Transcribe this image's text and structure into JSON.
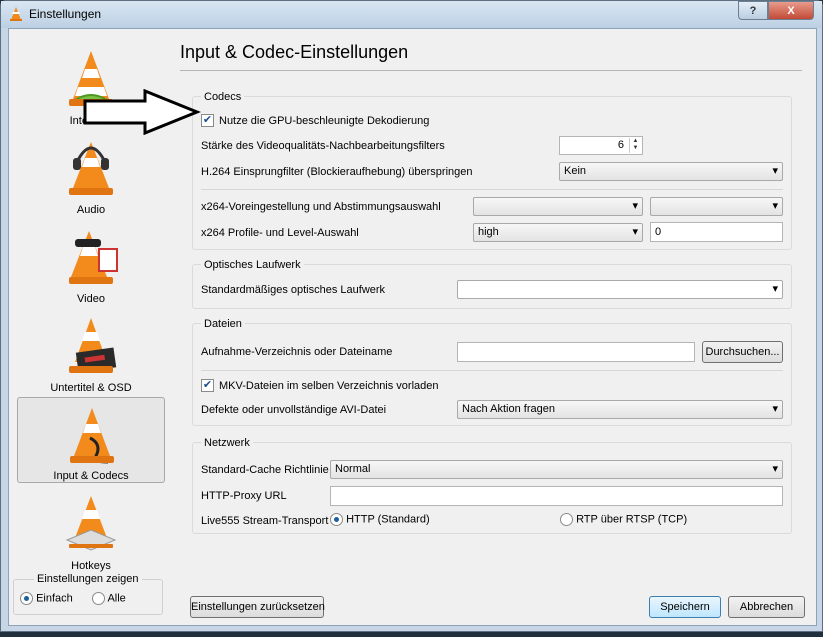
{
  "window": {
    "title": "Einstellungen",
    "help_label": "?",
    "close_label": "X"
  },
  "sidebar": {
    "items": [
      {
        "label": "Interface",
        "icon": "cone-interface-icon"
      },
      {
        "label": "Audio",
        "icon": "cone-audio-icon"
      },
      {
        "label": "Video",
        "icon": "cone-video-icon"
      },
      {
        "label": "Untertitel & OSD",
        "icon": "cone-subtitles-icon"
      },
      {
        "label": "Input & Codecs",
        "icon": "cone-input-codecs-icon",
        "selected": true
      },
      {
        "label": "Hotkeys",
        "icon": "cone-hotkeys-icon"
      }
    ],
    "show_settings": {
      "title": "Einstellungen zeigen",
      "simple": "Einfach",
      "all": "Alle",
      "selected": "Einfach"
    }
  },
  "page": {
    "title": "Input & Codec-Einstellungen"
  },
  "codecs": {
    "title": "Codecs",
    "gpu_label": "Nutze die GPU-beschleunigte Dekodierung",
    "gpu_checked": true,
    "pp_label": "Stärke des Videoqualitäts-Nachbearbeitungsfilters",
    "pp_value": "6",
    "h264_label": "H.264 Einsprungfilter (Blockieraufhebung) überspringen",
    "h264_value": "Kein",
    "x264_preset_label": "x264-Voreingestellung und Abstimmungsauswahl",
    "x264_preset_value": "",
    "x264_tune_value": "",
    "x264_profile_label": "x264 Profile- und Level-Auswahl",
    "x264_profile_value": "high",
    "x264_level_value": "0"
  },
  "optical": {
    "title": "Optisches Laufwerk",
    "drive_label": "Standardmäßiges optisches Laufwerk",
    "drive_value": ""
  },
  "files": {
    "title": "Dateien",
    "record_label": "Aufnahme-Verzeichnis oder Dateiname",
    "record_value": "",
    "browse_label": "Durchsuchen...",
    "mkv_label": "MKV-Dateien im selben Verzeichnis vorladen",
    "mkv_checked": true,
    "avi_label": "Defekte oder unvollständige AVI-Datei",
    "avi_value": "Nach Aktion fragen"
  },
  "network": {
    "title": "Netzwerk",
    "cache_label": "Standard-Cache Richtlinie",
    "cache_value": "Normal",
    "proxy_label": "HTTP-Proxy URL",
    "proxy_value": "",
    "live555_label": "Live555 Stream-Transport",
    "http_label": "HTTP (Standard)",
    "rtp_label": "RTP über RTSP (TCP)",
    "transport_selected": "HTTP (Standard)"
  },
  "footer": {
    "reset_label": "Einstellungen zurücksetzen",
    "save_label": "Speichern",
    "cancel_label": "Abbrechen"
  },
  "colors": {
    "cone_orange": "#f28a1c",
    "titlebar": "#c6d6e6",
    "selected_radio": "#1c5f9e"
  }
}
